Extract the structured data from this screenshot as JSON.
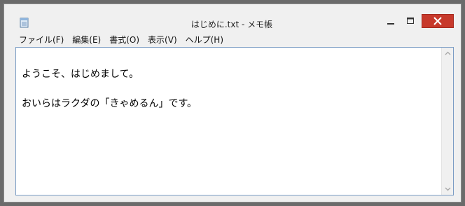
{
  "window": {
    "title": "はじめに.txt - メモ帳",
    "icon": "notepad-icon",
    "controls": {
      "minimize_icon": "minimize-icon",
      "maximize_icon": "maximize-icon",
      "close_icon": "close-icon",
      "close_color": "#c7392b"
    }
  },
  "menu": {
    "items": [
      {
        "label": "ファイル(F)"
      },
      {
        "label": "編集(E)"
      },
      {
        "label": "書式(O)"
      },
      {
        "label": "表示(V)"
      },
      {
        "label": "ヘルプ(H)"
      }
    ]
  },
  "editor": {
    "lines": [
      "ようこそ、はじめまして。",
      "おいらはラクダの「きゃめるん」です。"
    ],
    "border_color": "#7a9cc4"
  },
  "scrollbar": {
    "up_icon": "scroll-up-arrow-icon",
    "down_icon": "scroll-down-arrow-icon"
  }
}
